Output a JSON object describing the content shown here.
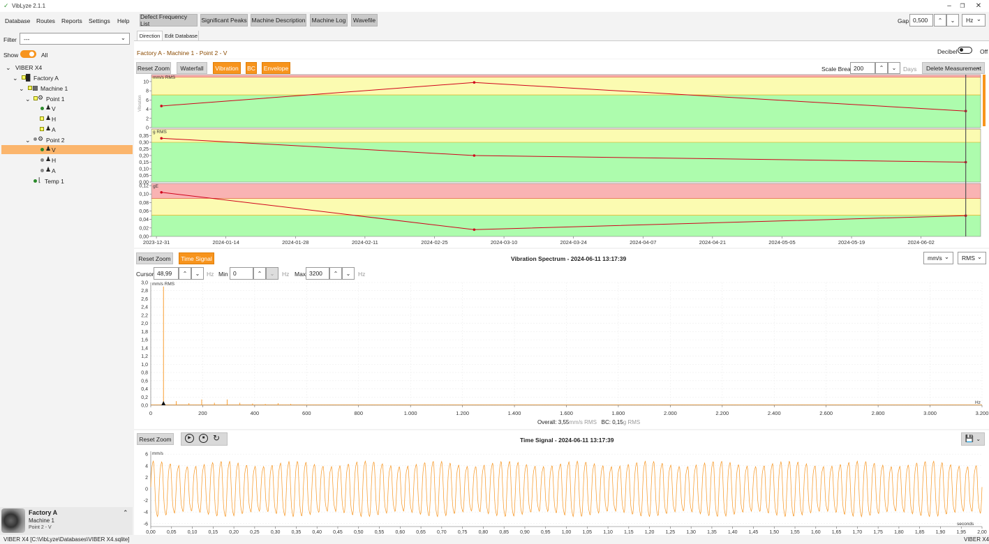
{
  "app": {
    "title": "VibLyze 2.1.1"
  },
  "menu": {
    "items": [
      "Database",
      "Routes",
      "Reports",
      "Settings",
      "Help"
    ]
  },
  "toolbar": {
    "buttons": [
      "Defect Frequency List",
      "Significant Peaks",
      "Machine Description",
      "Machine Log",
      "Wavefile"
    ]
  },
  "gap": {
    "label": "Gap",
    "value": "0,500",
    "unit": "Hz"
  },
  "sidebar": {
    "filter_label": "Filter",
    "filter_value": "---",
    "show_label": "Show",
    "show_value": "All",
    "tree": [
      {
        "label": "VIBER X4"
      },
      {
        "label": "Factory A"
      },
      {
        "label": "Machine 1"
      },
      {
        "label": "Point 1"
      },
      {
        "label": "V"
      },
      {
        "label": "H"
      },
      {
        "label": "A"
      },
      {
        "label": "Point 2"
      },
      {
        "label": "V"
      },
      {
        "label": "H"
      },
      {
        "label": "A"
      },
      {
        "label": "Temp 1"
      }
    ],
    "footer": {
      "factory": "Factory A",
      "machine": "Machine 1",
      "point": "Point 2 - V"
    }
  },
  "tabs": [
    "Direction",
    "Edit Database"
  ],
  "breadcrumb": "Factory A - Machine 1 - Point 2 - V",
  "decibel": {
    "label": "Decibel",
    "state": "Off"
  },
  "trend": {
    "buttons": {
      "reset_zoom": "Reset Zoom",
      "waterfall": "Waterfall",
      "vibration": "Vibration",
      "bc": "BC",
      "envelope": "Envelope"
    },
    "scale_break_label": "Scale Break",
    "scale_break_value": "200",
    "scale_break_unit": "Days",
    "delete_label": "Delete Measurement",
    "x_ticks": [
      "2023-12-31",
      "2024-01-14",
      "2024-01-28",
      "2024-02-11",
      "2024-02-25",
      "2024-03-10",
      "2024-03-24",
      "2024-04-07",
      "2024-04-21",
      "2024-05-05",
      "2024-05-19",
      "2024-06-02"
    ]
  },
  "spectrum": {
    "reset_zoom": "Reset Zoom",
    "time_signal_btn": "Time Signal",
    "title": "Vibration Spectrum - 2024-06-11 13:17:39",
    "unit_select": "mm/s",
    "mode_select": "RMS",
    "cursor_label": "Cursor",
    "cursor_value": "48,99",
    "min_label": "Min",
    "min_value": "0",
    "max_label": "Max",
    "max_value": "3200",
    "hz": "Hz",
    "overall_label": "Overall:",
    "overall_value": "3,55",
    "overall_unit": "mm/s RMS",
    "bc_label": "BC:",
    "bc_value": "0,15",
    "bc_unit": "g RMS"
  },
  "timesignal": {
    "reset_zoom": "Reset Zoom",
    "title": "Time Signal - 2024-06-11 13:17:39"
  },
  "status": {
    "left": "VIBER X4  [C:\\VibLyze\\Databases\\VIBER X4.sqlite]",
    "right": "VIBER X4"
  },
  "chart_data": [
    {
      "type": "line",
      "ylabel": "Vibration",
      "unit": "mm/s RMS",
      "x": [
        "2024-01-01",
        "2024-03-04",
        "2024-06-11"
      ],
      "values": [
        4.7,
        9.8,
        3.6
      ],
      "ylim": [
        0,
        11.5
      ],
      "yticks": [
        "0",
        "2",
        "4",
        "6",
        "8",
        "10"
      ],
      "alarm_bands": {
        "green_max": 7.1,
        "yellow_max": 11,
        "red_max": 11.5
      },
      "colors": {
        "line": "#d0021b",
        "green": "#adfcad",
        "yellow": "#fbfbb1",
        "red": "#f9b3b3"
      }
    },
    {
      "type": "line",
      "ylabel": "BC",
      "unit": "g RMS",
      "x": [
        "2024-01-01",
        "2024-03-04",
        "2024-06-11"
      ],
      "values": [
        0.33,
        0.2,
        0.15
      ],
      "ylim": [
        0,
        0.4
      ],
      "yticks": [
        "0,00",
        "0,05",
        "0,10",
        "0,15",
        "0,20",
        "0,25",
        "0,30",
        "0,35"
      ],
      "alarm_bands": {
        "green_max": 0.3,
        "yellow_max": 0.4
      }
    },
    {
      "type": "line",
      "ylabel": "Envelope",
      "unit": "gE",
      "x": [
        "2024-01-01",
        "2024-03-04",
        "2024-06-11"
      ],
      "values": [
        0.104,
        0.016,
        0.049
      ],
      "ylim": [
        0,
        0.125
      ],
      "yticks": [
        "0,00",
        "0,02",
        "0,04",
        "0,06",
        "0,08",
        "0,10",
        "0,12"
      ],
      "alarm_bands": {
        "green_max": 0.05,
        "yellow_max": 0.09,
        "red_max": 0.125
      }
    },
    {
      "type": "line",
      "title": "Vibration Spectrum - 2024-06-11 13:17:39",
      "unit": "mm/s RMS",
      "xlabel": "Hz",
      "xlim": [
        0,
        3200
      ],
      "ylim": [
        0,
        3.0
      ],
      "xticks": [
        "0",
        "200",
        "400",
        "600",
        "800",
        "1.000",
        "1.200",
        "1.400",
        "1.600",
        "1.800",
        "2.000",
        "2.200",
        "2.400",
        "2.600",
        "2.800",
        "3.000",
        "3.200"
      ],
      "yticks": [
        "0,0",
        "0,2",
        "0,4",
        "0,6",
        "0,8",
        "1,0",
        "1,2",
        "1,4",
        "1,6",
        "1,8",
        "2,0",
        "2,2",
        "2,4",
        "2,6",
        "2,8",
        "3,0"
      ],
      "peaks": [
        {
          "x": 49,
          "y": 2.9
        },
        {
          "x": 98,
          "y": 0.1
        },
        {
          "x": 147,
          "y": 0.05
        },
        {
          "x": 196,
          "y": 0.14
        },
        {
          "x": 245,
          "y": 0.06
        },
        {
          "x": 294,
          "y": 0.14
        },
        {
          "x": 343,
          "y": 0.06
        },
        {
          "x": 392,
          "y": 0.04
        },
        {
          "x": 441,
          "y": 0.03
        },
        {
          "x": 490,
          "y": 0.05
        },
        {
          "x": 539,
          "y": 0.03
        }
      ],
      "color": "#f7941d"
    },
    {
      "type": "line",
      "title": "Time Signal - 2024-06-11 13:17:39",
      "unit": "mm/s",
      "xlabel": "seconds",
      "xlim": [
        0,
        2.0
      ],
      "ylim": [
        -6.5,
        6.5
      ],
      "frequency_hz": 49,
      "amplitude": 5.0,
      "xticks": [
        "0,00",
        "0,05",
        "0,10",
        "0,15",
        "0,20",
        "0,25",
        "0,30",
        "0,35",
        "0,40",
        "0,45",
        "0,50",
        "0,55",
        "0,60",
        "0,65",
        "0,70",
        "0,75",
        "0,80",
        "0,85",
        "0,90",
        "0,95",
        "1,00",
        "1,05",
        "1,10",
        "1,15",
        "1,20",
        "1,25",
        "1,30",
        "1,35",
        "1,40",
        "1,45",
        "1,50",
        "1,55",
        "1,60",
        "1,65",
        "1,70",
        "1,75",
        "1,80",
        "1,85",
        "1,90",
        "1,95",
        "2,00"
      ],
      "yticks": [
        "-6",
        "-4",
        "-2",
        "0",
        "2",
        "4",
        "6"
      ],
      "color": "#f7941d"
    }
  ]
}
